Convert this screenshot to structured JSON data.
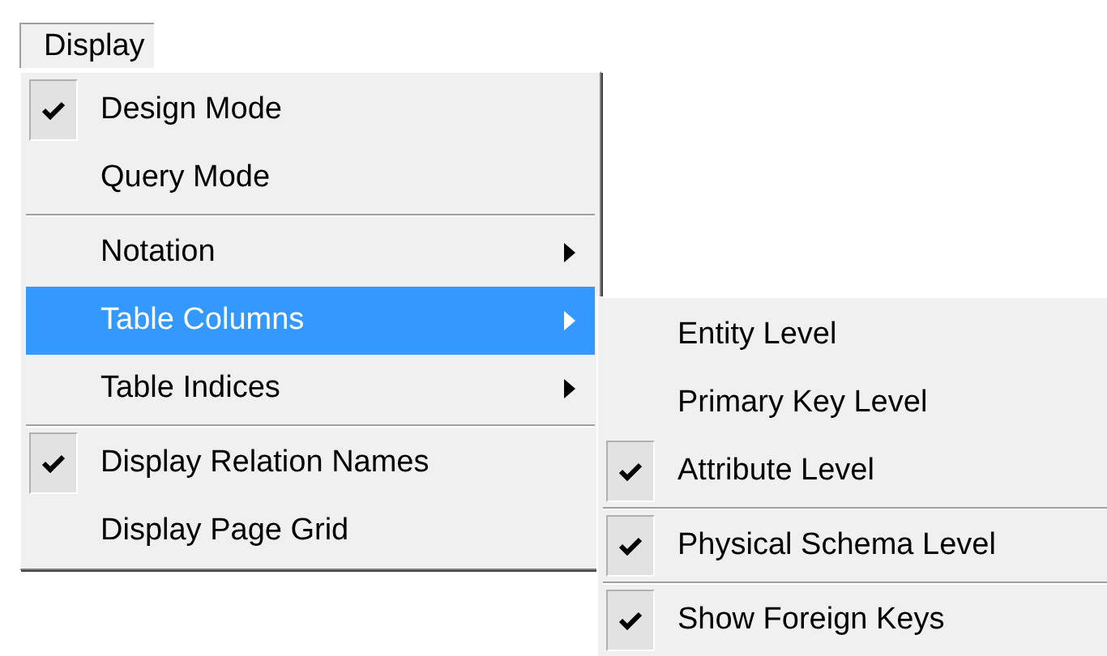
{
  "menu_bar": [
    {
      "label": "Display",
      "selected": true
    }
  ],
  "menu": {
    "items": [
      {
        "kind": "item",
        "label": "Design Mode",
        "checked": true,
        "selected": false
      },
      {
        "kind": "item",
        "label": "Query Mode",
        "checked": false,
        "selected": false
      },
      {
        "kind": "separator"
      },
      {
        "kind": "submenu",
        "label": "Notation",
        "selected": false
      },
      {
        "kind": "submenu",
        "label": "Table Columns",
        "selected": true
      },
      {
        "kind": "submenu",
        "label": "Table Indices",
        "selected": false
      },
      {
        "kind": "separator"
      },
      {
        "kind": "item",
        "label": "Display Relation Names",
        "checked": true,
        "selected": false
      },
      {
        "kind": "item",
        "label": "Display Page Grid",
        "checked": false,
        "selected": false
      }
    ]
  },
  "submenu": {
    "items": [
      {
        "kind": "item",
        "label": "Entity Level",
        "checked": false,
        "selected": false
      },
      {
        "kind": "item",
        "label": "Primary Key Level",
        "checked": false,
        "selected": false
      },
      {
        "kind": "item",
        "label": "Attribute Level",
        "checked": true,
        "selected": false
      },
      {
        "kind": "separator"
      },
      {
        "kind": "item",
        "label": "Physical Schema Level",
        "checked": true,
        "selected": false
      },
      {
        "kind": "separator"
      },
      {
        "kind": "item",
        "label": "Show Foreign Keys",
        "checked": true,
        "selected": false
      }
    ]
  }
}
